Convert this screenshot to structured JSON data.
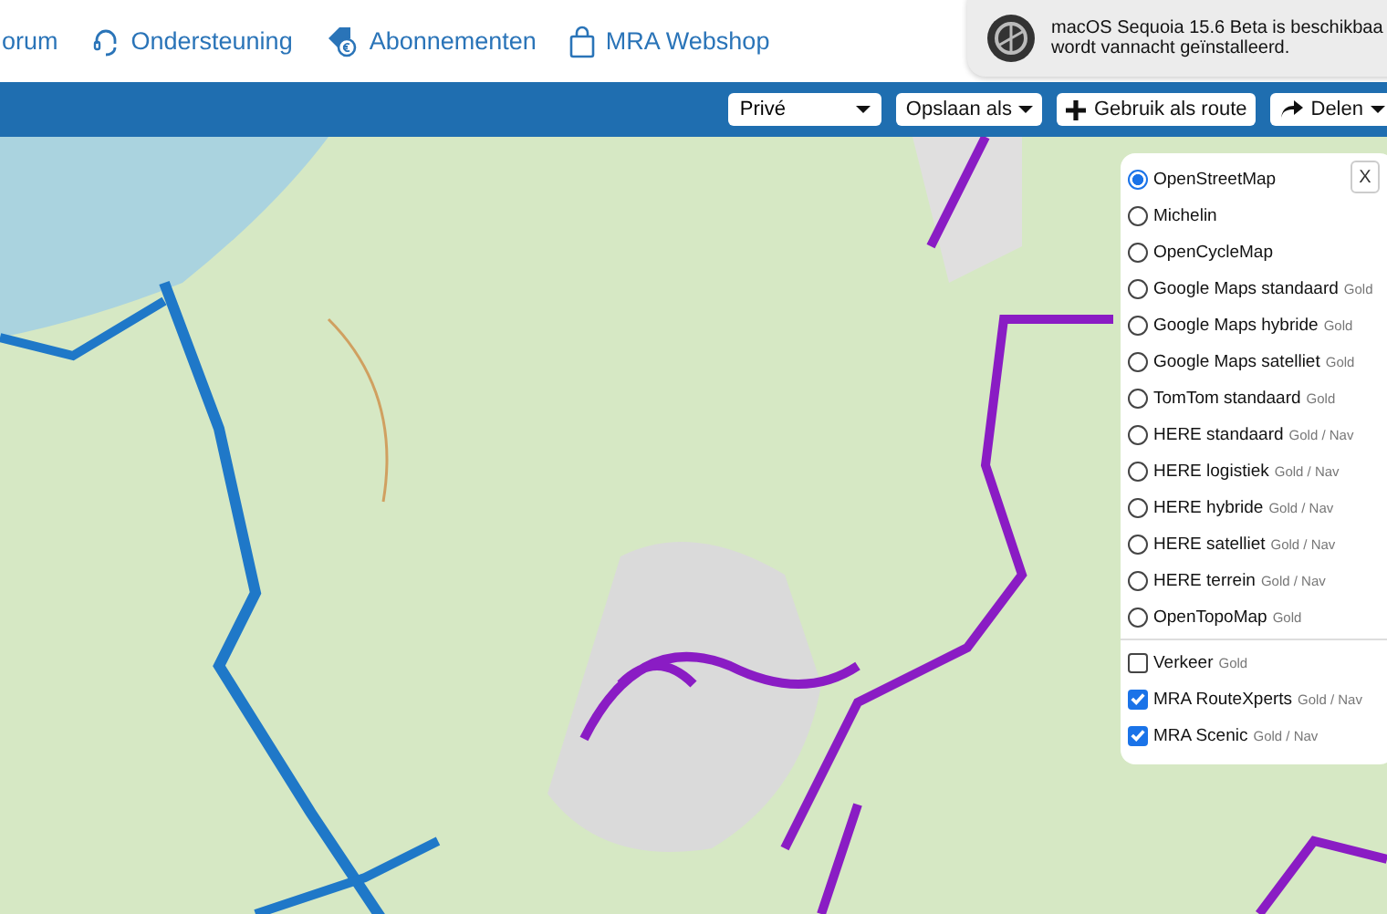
{
  "nav": [
    {
      "label": "orum"
    },
    {
      "label": "Ondersteuning"
    },
    {
      "label": "Abonnementen"
    },
    {
      "label": "MRA Webshop"
    }
  ],
  "notification": {
    "lines": [
      "macOS Sequoia 15.6 Beta is beschikbaa",
      "wordt vannacht geïnstalleerd."
    ]
  },
  "toolbar": {
    "visibility": "Privé",
    "buttons": [
      {
        "label": "Opslaan als",
        "kind": "dropdown"
      },
      {
        "label": "Gebruik als route",
        "kind": "plus"
      },
      {
        "label": "Delen",
        "kind": "share"
      }
    ]
  },
  "layers": {
    "close": "X",
    "base_layers": [
      {
        "label": "OpenStreetMap",
        "selected": true
      },
      {
        "label": "Michelin",
        "selected": false
      },
      {
        "label": "OpenCycleMap",
        "selected": false
      },
      {
        "label": "Google Maps standaard",
        "tier": "Gold",
        "selected": false
      },
      {
        "label": "Google Maps hybride",
        "tier": "Gold",
        "selected": false
      },
      {
        "label": "Google Maps satelliet",
        "tier": "Gold",
        "selected": false
      },
      {
        "label": "TomTom standaard",
        "tier": "Gold",
        "selected": false
      },
      {
        "label": "HERE standaard",
        "tier": "Gold / Nav",
        "selected": false
      },
      {
        "label": "HERE logistiek",
        "tier": "Gold / Nav",
        "selected": false
      },
      {
        "label": "HERE hybride",
        "tier": "Gold / Nav",
        "selected": false
      },
      {
        "label": "HERE satelliet",
        "tier": "Gold / Nav",
        "selected": false
      },
      {
        "label": "HERE terrein",
        "tier": "Gold / Nav",
        "selected": false
      },
      {
        "label": "OpenTopoMap",
        "tier": "Gold",
        "selected": false
      }
    ],
    "overlays": [
      {
        "label": "Verkeer",
        "tier": "Gold",
        "checked": false
      },
      {
        "label": "MRA RouteXperts",
        "tier": "Gold / Nav",
        "checked": true
      },
      {
        "label": "MRA Scenic",
        "tier": "Gold / Nav",
        "checked": true
      }
    ]
  }
}
